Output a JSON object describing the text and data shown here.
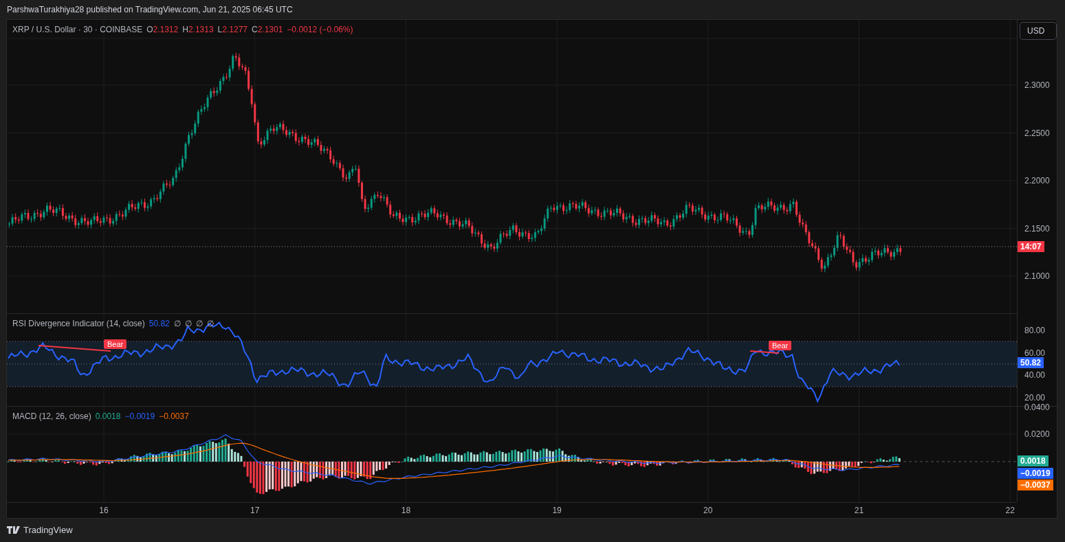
{
  "header": {
    "text": "ParshwaTurakhiya28 published on TradingView.com, Jun 21, 2025 06:45 UTC"
  },
  "legend": {
    "symbol": "XRP / U.S. Dollar · 30 · COINBASE",
    "ohlc": [
      {
        "label": "O",
        "value": "2.1312"
      },
      {
        "label": "H",
        "value": "2.1313"
      },
      {
        "label": "L",
        "value": "2.1277"
      },
      {
        "label": "C",
        "value": "2.1301"
      }
    ],
    "change": "−0.0012 (−0.06%)"
  },
  "currency_button": "USD",
  "price_axis": [
    "2.3000",
    "2.2500",
    "2.2000",
    "2.1500",
    "2.1000"
  ],
  "countdown": "14:07",
  "rsi": {
    "title": "RSI Divergence Indicator (14, close)",
    "value": "50.82",
    "extras": [
      "∅",
      "∅",
      "∅",
      "∅"
    ],
    "axis": [
      "80.00",
      "60.00",
      "40.00",
      "20.00"
    ],
    "badge": "50.82",
    "signals": [
      "Bear",
      "Bear"
    ]
  },
  "macd": {
    "title": "MACD (12, 26, close)",
    "values": [
      {
        "text": "0.0018",
        "color": "#22ab94"
      },
      {
        "text": "−0.0019",
        "color": "#2962ff"
      },
      {
        "text": "−0.0037",
        "color": "#ff6d00"
      }
    ],
    "axis": [
      "0.0400",
      "0.0200"
    ],
    "badges": [
      {
        "text": "0.0018",
        "color": "#22ab94"
      },
      {
        "text": "−0.0019",
        "color": "#2962ff"
      },
      {
        "text": "−0.0037",
        "color": "#ff6d00"
      }
    ]
  },
  "time_axis": [
    "16",
    "17",
    "18",
    "19",
    "20",
    "21",
    "22"
  ],
  "footer": {
    "brand": "TradingView"
  }
}
